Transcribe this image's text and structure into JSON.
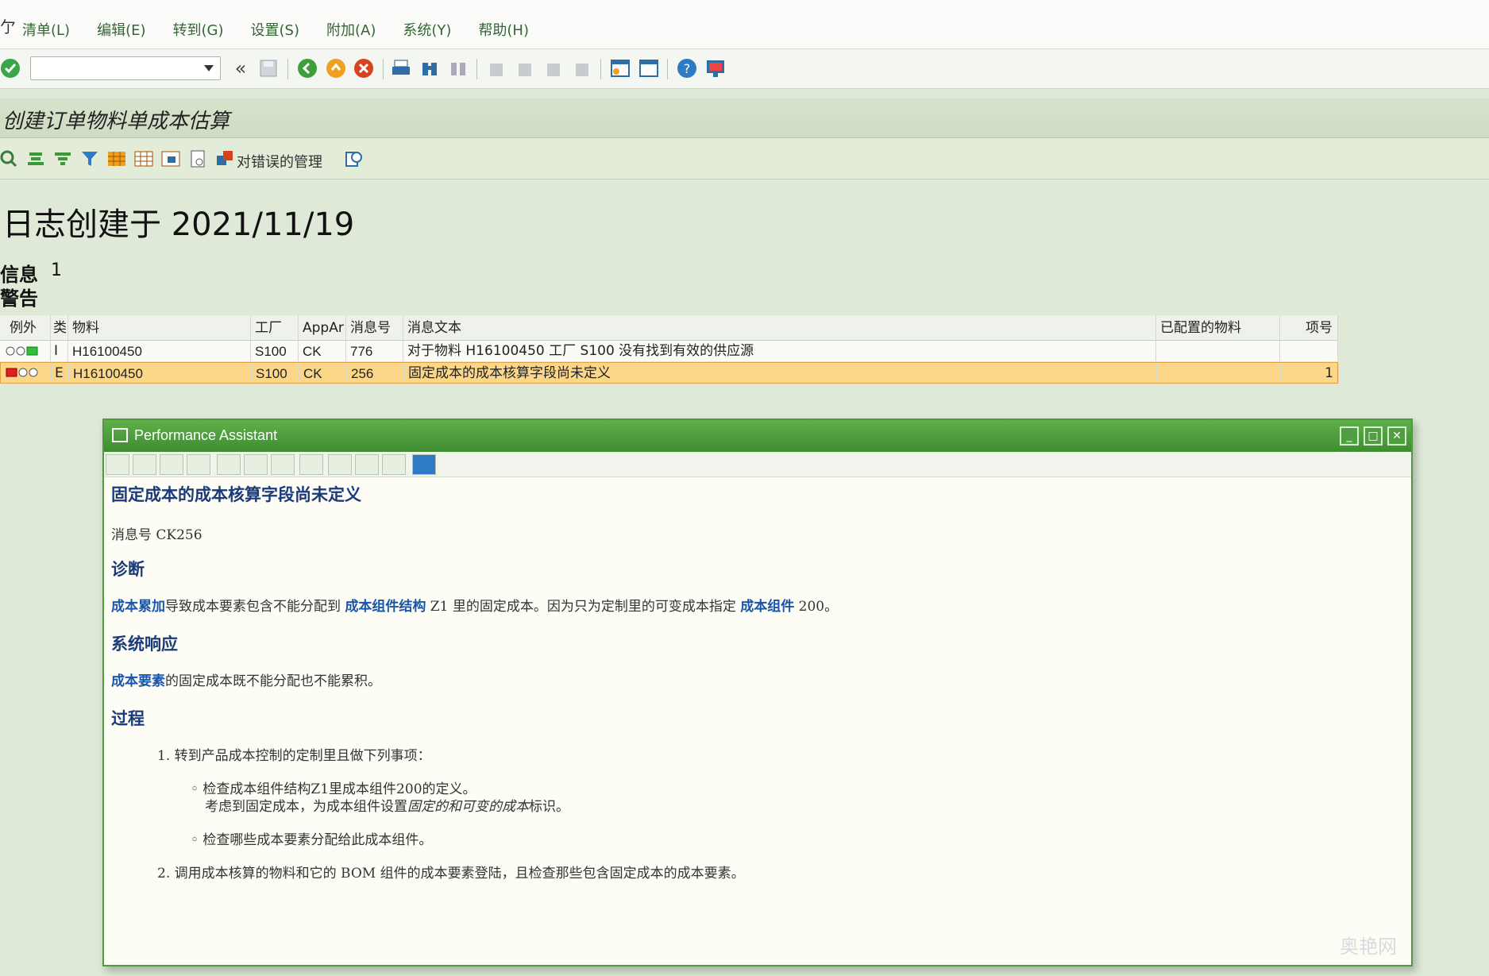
{
  "menu": {
    "items": [
      "清单(L)",
      "编辑(E)",
      "转到(G)",
      "设置(S)",
      "附加(A)",
      "系统(Y)",
      "帮助(H)"
    ]
  },
  "toolbar": {
    "command_field_value": "",
    "icons": [
      "enter-icon",
      "back-arrows-icon",
      "save-icon",
      "back-icon",
      "exit-icon",
      "cancel-icon",
      "print-icon",
      "find-icon",
      "find-next-icon",
      "first-page-icon",
      "previous-page-icon",
      "next-page-icon",
      "last-page-icon",
      "new-session-icon",
      "shortcut-icon",
      "help-icon",
      "layout-icon"
    ]
  },
  "title": "创建订单物料单成本估算",
  "app_toolbar": {
    "error_management_label": "对错误的管理"
  },
  "log": {
    "heading": "日志创建于 2021/11/19",
    "info_label": "信息",
    "info_count": "1",
    "warning_label": "警告"
  },
  "grid": {
    "columns": [
      "例外",
      "类",
      "物料",
      "工厂",
      "AppAr",
      "消息号",
      "消息文本",
      "已配置的物料",
      "项号"
    ],
    "rows": [
      {
        "exception": "green",
        "type": "I",
        "material": "H16100450",
        "plant": "S100",
        "appar": "CK",
        "msgno": "776",
        "text": "对于物料 H16100450 工厂 S100 没有找到有效的供应源",
        "configured": "",
        "item": ""
      },
      {
        "exception": "red",
        "type": "E",
        "material": "H16100450",
        "plant": "S100",
        "appar": "CK",
        "msgno": "256",
        "text": "固定成本的成本核算字段尚未定义",
        "configured": "",
        "item": "1"
      }
    ]
  },
  "popup": {
    "title": "Performance Assistant",
    "heading": "固定成本的成本核算字段尚未定义",
    "msgno_label": "消息号 CK256",
    "diag_title": "诊断",
    "diag_link1": "成本累加",
    "diag_text1": "导致成本要素包含不能分配到 ",
    "diag_link2": "成本组件结构",
    "diag_text2": " Z1 里的固定成本。因为只为定制里的可变成本指定 ",
    "diag_link3": "成本组件",
    "diag_text3": " 200。",
    "resp_title": "系统响应",
    "resp_link": "成本要素",
    "resp_text": "的固定成本既不能分配也不能累积。",
    "proc_title": "过程",
    "step1": "1. 转到产品成本控制的定制里且做下列事项：",
    "bullet1_line1": "◦ 检查成本组件结构Z1里成本组件200的定义。",
    "bullet1_line2_pre": "考虑到固定成本，为成本组件设置",
    "bullet1_line2_em": "固定的和可变的成本",
    "bullet1_line2_post": "标识。",
    "bullet2": "◦ 检查哪些成本要素分配给此成本组件。",
    "step2": "2. 调用成本核算的物料和它的 BOM 组件的成本要素登陆，且检查那些包含固定成本的成本要素。"
  },
  "watermark": "奥艳网",
  "colors": {
    "accent_green": "#4f9a3e",
    "link_blue": "#1a55a8",
    "selected_row": "#fcd789"
  }
}
